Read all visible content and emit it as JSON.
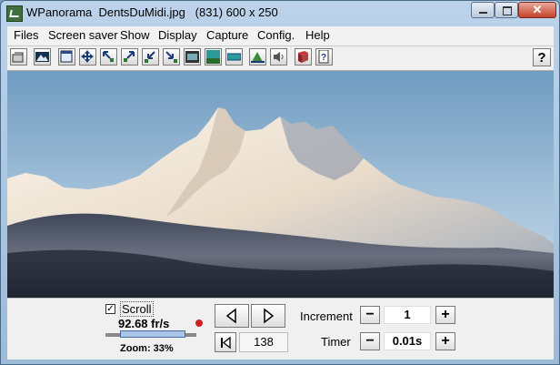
{
  "window": {
    "title": "WPanorama  DentsDuMidi.jpg   (831) 600 x 250",
    "close_glyph": "✕"
  },
  "menu": [
    "Files",
    "Screen saver",
    "Show",
    "Display",
    "Capture",
    "Config.",
    "Help"
  ],
  "toolbar": {
    "buttons": [
      "open-icon",
      "image-icon",
      "window-fit-icon",
      "move-icon",
      "zoom-out-icon",
      "zoom-in-icon",
      "shrink-icon",
      "expand-icon",
      "film-icon",
      "landscape-icon",
      "panorama-icon",
      "mountain-icon",
      "sound-icon",
      "book-icon",
      "help-page-icon"
    ],
    "help_label": "?"
  },
  "controls": {
    "scroll_label": "Scroll",
    "scroll_checked": true,
    "speed": "92.68 fr/s",
    "zoom": "Zoom: 33%",
    "zoom_fraction": 0.33,
    "position": "138",
    "increment_label": "Increment",
    "increment_value": "1",
    "timer_label": "Timer",
    "timer_value": "0.01s",
    "minus": "−",
    "plus": "+"
  },
  "colors": {
    "sky": "#7aa3c4",
    "accent": "#4a6fa5"
  }
}
